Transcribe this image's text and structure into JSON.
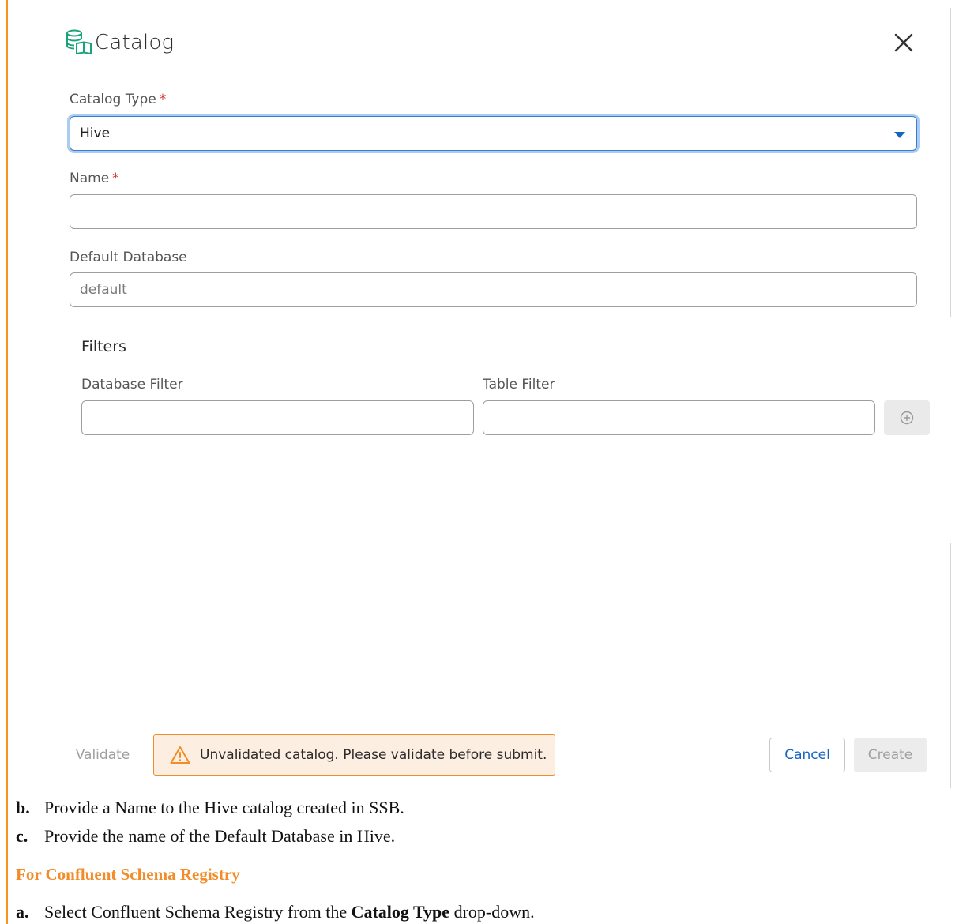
{
  "dialog": {
    "title": "Catalog"
  },
  "form": {
    "catalog_type": {
      "label": "Catalog Type",
      "required_mark": "*",
      "value": "Hive"
    },
    "name": {
      "label": "Name",
      "required_mark": "*",
      "value": "",
      "placeholder": ""
    },
    "default_database": {
      "label": "Default Database",
      "value": "",
      "placeholder": "default"
    },
    "filters": {
      "title": "Filters",
      "database_filter": {
        "label": "Database Filter",
        "value": ""
      },
      "table_filter": {
        "label": "Table Filter",
        "value": ""
      }
    }
  },
  "footer": {
    "validate_label": "Validate",
    "warning_text": "Unvalidated catalog. Please validate before submit.",
    "cancel_label": "Cancel",
    "create_label": "Create"
  },
  "document": {
    "step_b": {
      "marker": "b.",
      "text": "Provide a Name to the Hive catalog created in SSB."
    },
    "step_c": {
      "marker": "c.",
      "text": "Provide the name of the Default Database in Hive."
    },
    "section_heading": "For Confluent Schema Registry",
    "step_a": {
      "marker": "a.",
      "text_before": "Select Confluent Schema Registry from the",
      "bold": "Catalog Type",
      "text_after": "drop-down."
    }
  },
  "colors": {
    "accent_orange": "#f28c28",
    "focus_blue": "#3a7bd5",
    "required_red": "#d32f2f",
    "link_blue": "#1565c0",
    "catalog_icon_green": "#1aa37a"
  }
}
